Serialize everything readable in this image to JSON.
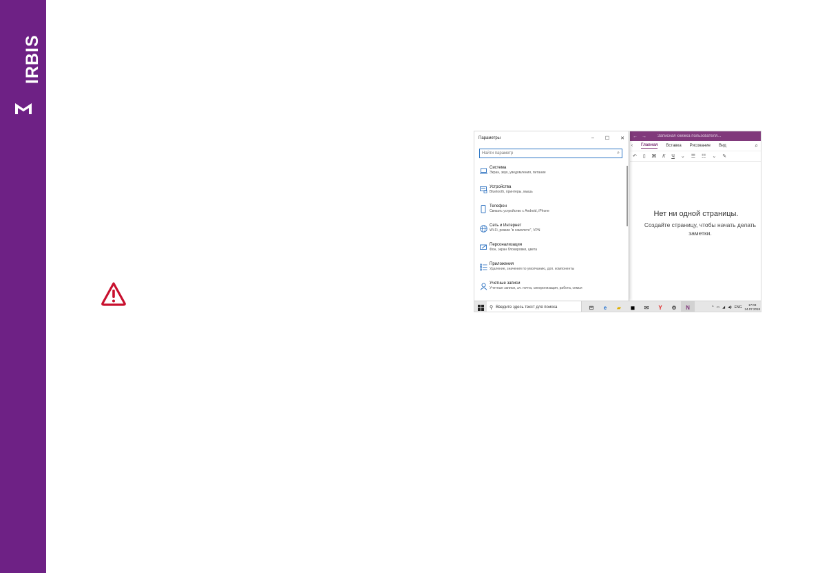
{
  "brand": {
    "name": "IRBIS",
    "bar_color": "#6e2185"
  },
  "settings": {
    "title": "Параметры",
    "controls": {
      "minimize": "–",
      "maximize": "☐",
      "close": "✕"
    },
    "search_placeholder": "Найти параметр",
    "items": [
      {
        "icon": "laptop-icon",
        "name": "Система",
        "desc": "Экран, звук, уведомления, питание"
      },
      {
        "icon": "devices-icon",
        "name": "Устройства",
        "desc": "Bluetooth, принтеры, мышь"
      },
      {
        "icon": "phone-icon",
        "name": "Телефон",
        "desc": "Связать устройство с Android, iPhone"
      },
      {
        "icon": "globe-icon",
        "name": "Сеть и Интернет",
        "desc": "Wi-Fi, режим \"в самолете\", VPN"
      },
      {
        "icon": "personalize-icon",
        "name": "Персонализация",
        "desc": "Фон, экран блокировки, цвета"
      },
      {
        "icon": "apps-icon",
        "name": "Приложения",
        "desc": "Удаление, значения по умолчанию, доп. компоненты"
      },
      {
        "icon": "account-icon",
        "name": "Учетные записи",
        "desc": "Учетные записи, эл. почта, синхронизация, работа, семья"
      }
    ]
  },
  "onenote": {
    "title": "Записная книжка пользователя...",
    "nav_back": "←",
    "nav_forward": "→",
    "tabs": [
      {
        "label": "Главная",
        "active": true
      },
      {
        "label": "Вставка",
        "active": false
      },
      {
        "label": "Рисование",
        "active": false
      },
      {
        "label": "Вид",
        "active": false
      }
    ],
    "tools": {
      "bold": "Ж",
      "italic": "К",
      "underline": "Ч"
    },
    "empty_title": "Нет ни одной страницы.",
    "empty_subtitle": "Создайте страницу, чтобы начать делать заметки.",
    "accent_color": "#80397b"
  },
  "taskbar": {
    "search_text": "Введите здесь текст для поиска",
    "lang": "ENG",
    "time": "17:03",
    "date": "24.07.2018"
  }
}
